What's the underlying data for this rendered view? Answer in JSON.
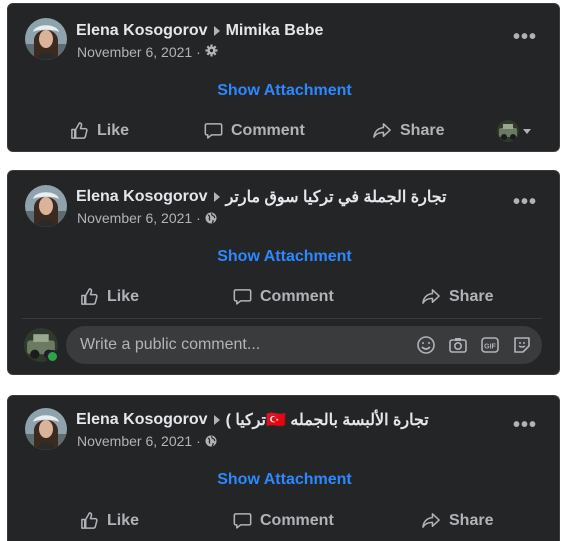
{
  "posts": [
    {
      "author": "Elena Kosogorov",
      "group": "Mimika Bebe",
      "date": "November 6, 2021 ·",
      "privacy_icon": "gear-icon",
      "attachment_label": "Show Attachment",
      "actions": {
        "like": "Like",
        "comment": "Comment",
        "share": "Share"
      }
    },
    {
      "author": "Elena Kosogorov",
      "group": "تجارة الجملة في تركيا سوق مارتر",
      "date": "November 6, 2021 ·",
      "privacy_icon": "globe-icon",
      "attachment_label": "Show Attachment",
      "actions": {
        "like": "Like",
        "comment": "Comment",
        "share": "Share"
      },
      "comment_placeholder": "Write a public comment...",
      "comment_icons": [
        "emoji-icon",
        "camera-icon",
        "gif-icon",
        "sticker-icon"
      ]
    },
    {
      "author": "Elena Kosogorov",
      "group": "تجارة الألبسة بالجمله 🇹🇷تركيا )",
      "date": "November 6, 2021 ·",
      "privacy_icon": "globe-icon",
      "attachment_label": "Show Attachment",
      "actions": {
        "like": "Like",
        "comment": "Comment",
        "share": "Share"
      }
    }
  ],
  "colors": {
    "card": "#242526",
    "link": "#2d88ff",
    "text": "#e4e6eb",
    "muted": "#b0b3b8"
  }
}
